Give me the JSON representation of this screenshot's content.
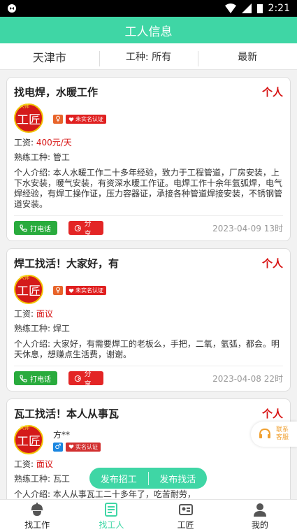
{
  "status": {
    "time": "2:21"
  },
  "title": "工人信息",
  "filters": {
    "city": "天津市",
    "trade": "工种: 所有",
    "sort": "最新"
  },
  "avatar_text": "工匠",
  "avatar_small": "大师",
  "cards": [
    {
      "title": "找电焊，水暖工作",
      "type": "个人",
      "name": "",
      "gender": "♀",
      "cert": "未实名认证",
      "wage_label": "工资: ",
      "wage": "400元/天",
      "skill": "熟练工种: 管工",
      "intro": "个人介绍: 本人水暖工作二十多年经验，致力于工程管道，厂房安装，上下水安装，暖气安装，有资深水暖工作证。电焊工作十余年氩弧焊，电气焊经验，有焊工操作证，压力容器证，承接各种管道焊接安装，不锈钢管道安装。",
      "call": "打电话",
      "share": "分享",
      "date": "2023-04-09 13时"
    },
    {
      "title": "焊工找活！大家好，有",
      "type": "个人",
      "name": "",
      "gender": "♀",
      "cert": "未实名认证",
      "wage_label": "工资: ",
      "wage": "面议",
      "skill": "熟练工种: 焊工",
      "intro": "个人介绍: 大家好，有需要焊工的老板么，手把，二氧，氩弧，都会。明天休息，想赚点生活费，谢谢。",
      "call": "打电话",
      "share": "分享",
      "date": "2023-04-08 22时"
    },
    {
      "title": "瓦工找活！本人从事瓦",
      "type": "个人",
      "name": "方**",
      "gender": "♂",
      "cert": "实名认证",
      "wage_label": "工资: ",
      "wage": "面议",
      "skill": "熟练工种: 瓦工",
      "intro": "个人介绍: 本人从事瓦工二十多年了，吃苦耐劳，"
    }
  ],
  "float": {
    "post_job": "发布招工",
    "post_work": "发布找活"
  },
  "service": "联系客服",
  "tabs": [
    {
      "label": "找工作",
      "icon": "worker-helmet-icon"
    },
    {
      "label": "找工人",
      "icon": "worker-list-icon"
    },
    {
      "label": "工匠",
      "icon": "id-card-icon"
    },
    {
      "label": "我的",
      "icon": "person-icon"
    }
  ],
  "colors": {
    "accent": "#3fd6a5",
    "red": "#d71414",
    "green": "#29ab3d"
  }
}
